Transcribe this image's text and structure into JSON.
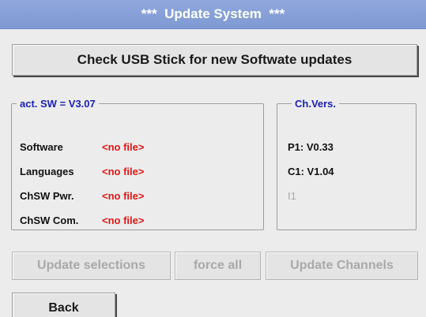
{
  "title": {
    "left_stars": "***",
    "text": "Update System",
    "right_stars": "***"
  },
  "check_usb_label": "Check USB Stick for new Softwate updates",
  "software_group": {
    "legend": "act. SW = V3.07",
    "rows": [
      {
        "label": "Software",
        "value": "<no file>"
      },
      {
        "label": "Languages",
        "value": "<no file>"
      },
      {
        "label": "ChSW Pwr.",
        "value": "<no file>"
      },
      {
        "label": "ChSW Com.",
        "value": "<no file>"
      }
    ]
  },
  "channel_group": {
    "legend": "Ch.Vers.",
    "rows": [
      {
        "label": "P1: V0.33"
      },
      {
        "label": "C1: V1.04"
      },
      {
        "label": "I1"
      }
    ]
  },
  "buttons": {
    "update_selections": "Update selections",
    "force_all": "force all",
    "update_channels": "Update Channels",
    "back": "Back"
  },
  "colors": {
    "title_bar": "#8fa7dc",
    "legend_text": "#1a1fb8",
    "no_file_text": "#e01616",
    "disabled_text": "#a9a9a9"
  }
}
